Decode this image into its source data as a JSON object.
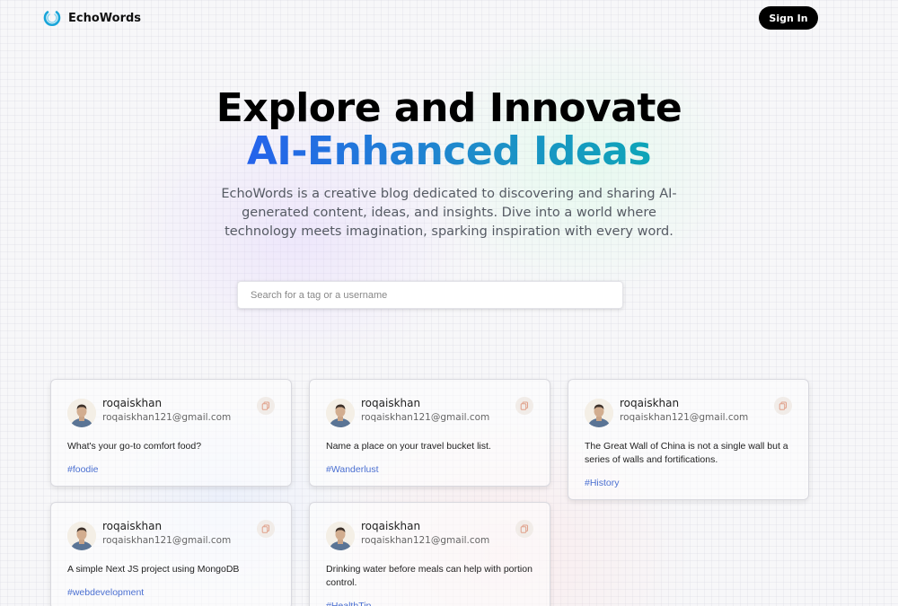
{
  "nav": {
    "brand": "EchoWords",
    "signin_label": "Sign In"
  },
  "hero": {
    "title_line1": "Explore and Innovate",
    "title_line2": "AI-Enhanced Ideas",
    "description": "EchoWords is a creative blog dedicated to discovering and sharing AI-generated content, ideas, and insights. Dive into a world where technology meets imagination, sparking inspiration with every word."
  },
  "search": {
    "placeholder": "Search for a tag or a username",
    "value": ""
  },
  "posts": [
    {
      "username": "roqaiskhan",
      "email": "roqaiskhan121@gmail.com",
      "text": "What's your go-to comfort food?",
      "tag": "#foodie"
    },
    {
      "username": "roqaiskhan",
      "email": "roqaiskhan121@gmail.com",
      "text": "Name a place on your travel bucket list.",
      "tag": "#Wanderlust"
    },
    {
      "username": "roqaiskhan",
      "email": "roqaiskhan121@gmail.com",
      "text": "The Great Wall of China is not a single wall but a series of walls and fortifications.",
      "tag": "#History"
    },
    {
      "username": "roqaiskhan",
      "email": "roqaiskhan121@gmail.com",
      "text": "A simple Next JS project using MongoDB",
      "tag": "#webdevelopment"
    },
    {
      "username": "roqaiskhan",
      "email": "roqaiskhan121@gmail.com",
      "text": "Drinking water before meals can help with portion control.",
      "tag": "#HealthTip"
    }
  ],
  "icons": {
    "logo": "echowords-logo",
    "copy": "copy-icon",
    "avatar": "user-avatar"
  },
  "colors": {
    "accent_start": "#2563eb",
    "accent_end": "#0ea5b8",
    "tag": "#4a6fd1",
    "button": "#000000"
  }
}
